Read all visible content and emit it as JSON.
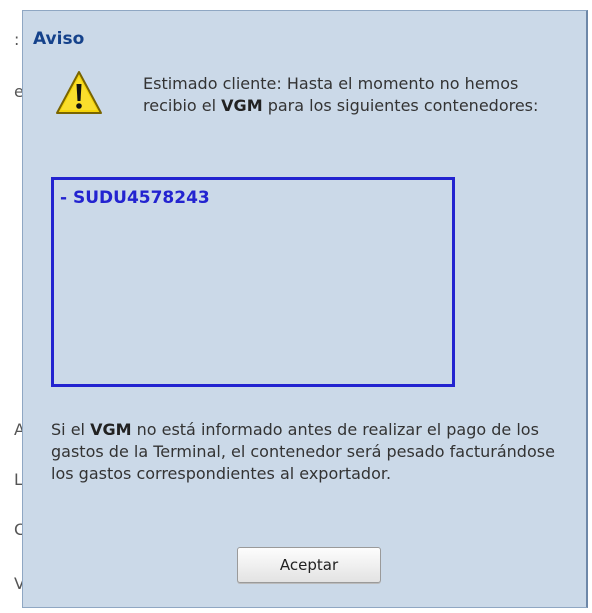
{
  "background": {
    "fragments": [
      "e",
      ":",
      "A",
      "L",
      "C",
      "V"
    ]
  },
  "dialog": {
    "title": "Aviso",
    "intro": {
      "part1": "Estimado cliente: Hasta el momento no hemos recibio el ",
      "bold": "VGM",
      "part2": " para los siguientes contenedores:"
    },
    "containers": [
      "- SUDU4578243"
    ],
    "footer": {
      "part1": "Si el ",
      "bold": "VGM",
      "part2": " no está informado antes de realizar el pago de los gastos de la Terminal, el contenedor será pesado facturándose los gastos correspondientes al exportador."
    },
    "accept_label": "Aceptar"
  },
  "colors": {
    "dialog_bg": "#cbd9e8",
    "title": "#15428b",
    "container_border": "#2323d0",
    "warning_yellow": "#f5d40a"
  },
  "icons": {
    "warning": "warning-icon"
  }
}
